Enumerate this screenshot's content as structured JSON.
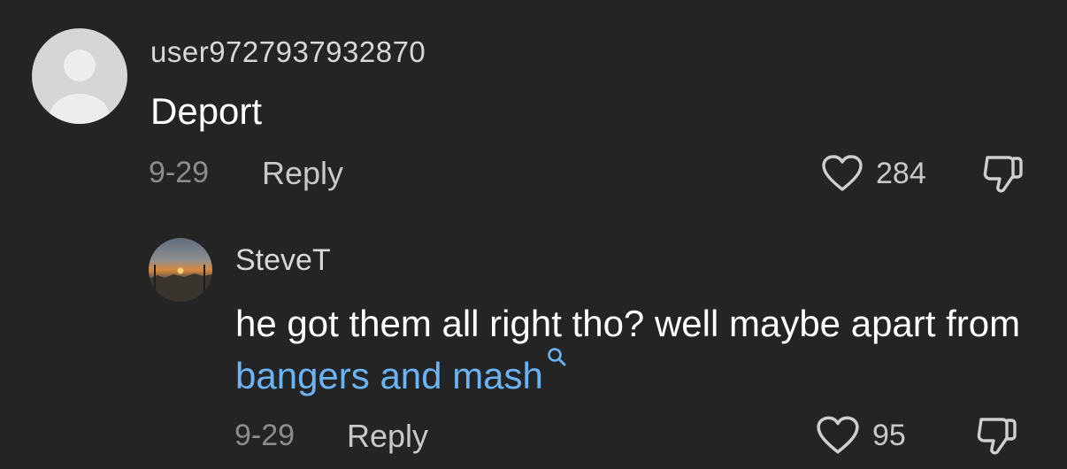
{
  "comments": [
    {
      "username": "user9727937932870",
      "text": "Deport",
      "date": "9-29",
      "reply_label": "Reply",
      "likes": "284",
      "avatar": "default-avatar"
    },
    {
      "username": "SteveT",
      "text_before": "he got them all right tho? well maybe apart from ",
      "link_text": "bangers and mash",
      "date": "9-29",
      "reply_label": "Reply",
      "likes": "95",
      "avatar": "sunset-photo-avatar"
    }
  ],
  "colors": {
    "background": "#242424",
    "link": "#6ab4f5",
    "muted": "#8c8c8c",
    "secondary": "#c9c9c9"
  },
  "icons": {
    "like": "heart-outline-icon",
    "dislike": "thumbs-down-outline-icon",
    "search": "search-icon"
  }
}
